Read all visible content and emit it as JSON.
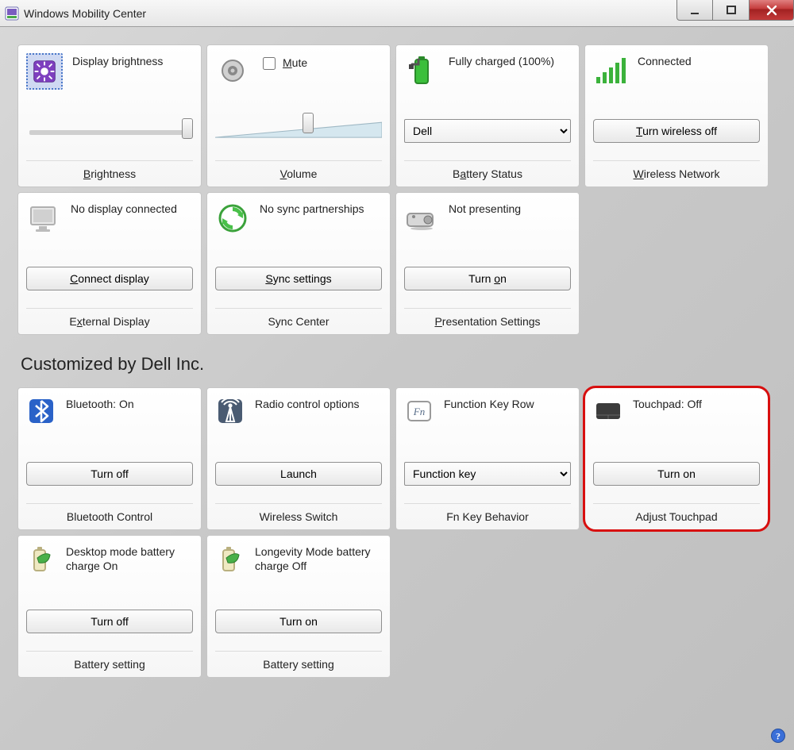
{
  "window": {
    "title": "Windows Mobility Center",
    "minimize": "Minimize",
    "maximize": "Maximize",
    "close": "Close"
  },
  "top_tiles": {
    "brightness": {
      "label": "Display brightness",
      "slider_value": 100,
      "footer": "Brightness"
    },
    "volume": {
      "mute_label": "Mute",
      "mute_checked": false,
      "slider_value": 55,
      "footer": "Volume"
    },
    "battery": {
      "status": "Fully charged (100%)",
      "plan_selected": "Dell",
      "footer": "Battery Status"
    },
    "wireless": {
      "status": "Connected",
      "button": "Turn wireless off",
      "footer": "Wireless Network"
    },
    "external": {
      "status": "No display connected",
      "button": "Connect display",
      "footer": "External Display"
    },
    "sync": {
      "status": "No sync partnerships",
      "button": "Sync settings",
      "footer": "Sync Center"
    },
    "presentation": {
      "status": "Not presenting",
      "button": "Turn on",
      "footer": "Presentation Settings"
    }
  },
  "custom_heading": "Customized by Dell Inc.",
  "custom_tiles": {
    "bluetooth": {
      "status": "Bluetooth: On",
      "button": "Turn off",
      "footer": "Bluetooth Control"
    },
    "radio": {
      "status": "Radio control options",
      "button": "Launch",
      "footer": "Wireless Switch"
    },
    "fnkey": {
      "status": "Function Key Row",
      "selected": "Function key",
      "footer": "Fn Key Behavior"
    },
    "touchpad": {
      "status": "Touchpad: Off",
      "button": "Turn on",
      "footer": "Adjust Touchpad"
    },
    "desktop_battery": {
      "status": "Desktop mode battery charge On",
      "button": "Turn off",
      "footer": "Battery setting"
    },
    "longevity_battery": {
      "status": "Longevity Mode battery charge Off",
      "button": "Turn on",
      "footer": "Battery setting"
    }
  }
}
